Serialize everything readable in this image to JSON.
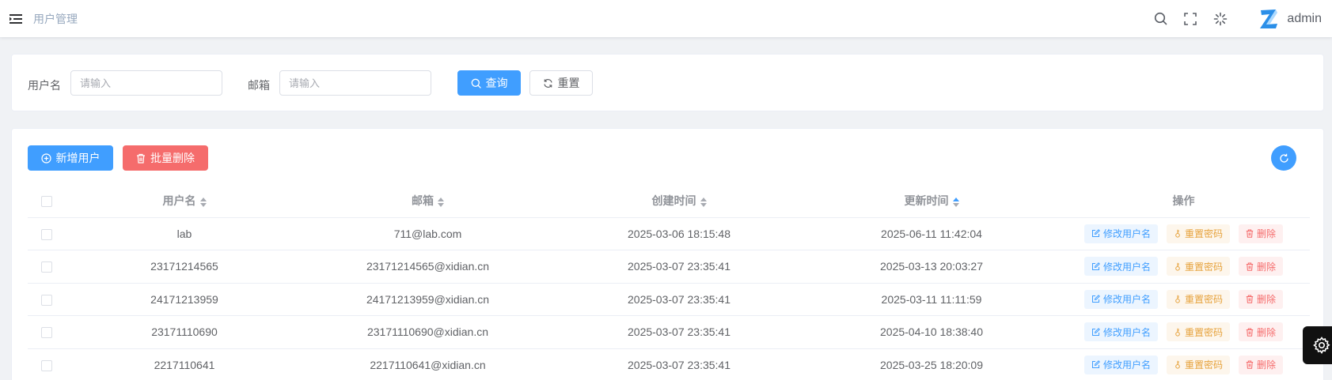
{
  "header": {
    "breadcrumb": "用户管理",
    "username": "admin",
    "icons": [
      "menu-fold-icon",
      "search-icon",
      "fullscreen-icon",
      "loading-icon",
      "z-logo-icon"
    ]
  },
  "search": {
    "username_label": "用户名",
    "username_placeholder": "请输入",
    "username_value": "",
    "email_label": "邮箱",
    "email_placeholder": "请输入",
    "email_value": "",
    "query_label": "查询",
    "reset_label": "重置"
  },
  "toolbar": {
    "add_label": "新增用户",
    "batch_delete_label": "批量删除"
  },
  "table": {
    "columns": [
      "用户名",
      "邮箱",
      "创建时间",
      "更新时间",
      "操作"
    ],
    "sorted_column": "更新时间",
    "actions": {
      "edit": "修改用户名",
      "reset": "重置密码",
      "delete": "删除"
    },
    "rows": [
      {
        "username": "lab",
        "email": "711@lab.com",
        "created": "2025-03-06 18:15:48",
        "updated": "2025-06-11 11:42:04"
      },
      {
        "username": "23171214565",
        "email": "23171214565@xidian.cn",
        "created": "2025-03-07 23:35:41",
        "updated": "2025-03-13 20:03:27"
      },
      {
        "username": "24171213959",
        "email": "24171213959@xidian.cn",
        "created": "2025-03-07 23:35:41",
        "updated": "2025-03-11 11:11:59"
      },
      {
        "username": "23171110690",
        "email": "23171110690@xidian.cn",
        "created": "2025-03-07 23:35:41",
        "updated": "2025-04-10 18:38:40"
      },
      {
        "username": "2217110641",
        "email": "2217110641@xidian.cn",
        "created": "2025-03-07 23:35:41",
        "updated": "2025-03-25 18:20:09"
      }
    ]
  },
  "colors": {
    "primary": "#409eff",
    "danger": "#f56c6c",
    "warning": "#e6a23c"
  }
}
